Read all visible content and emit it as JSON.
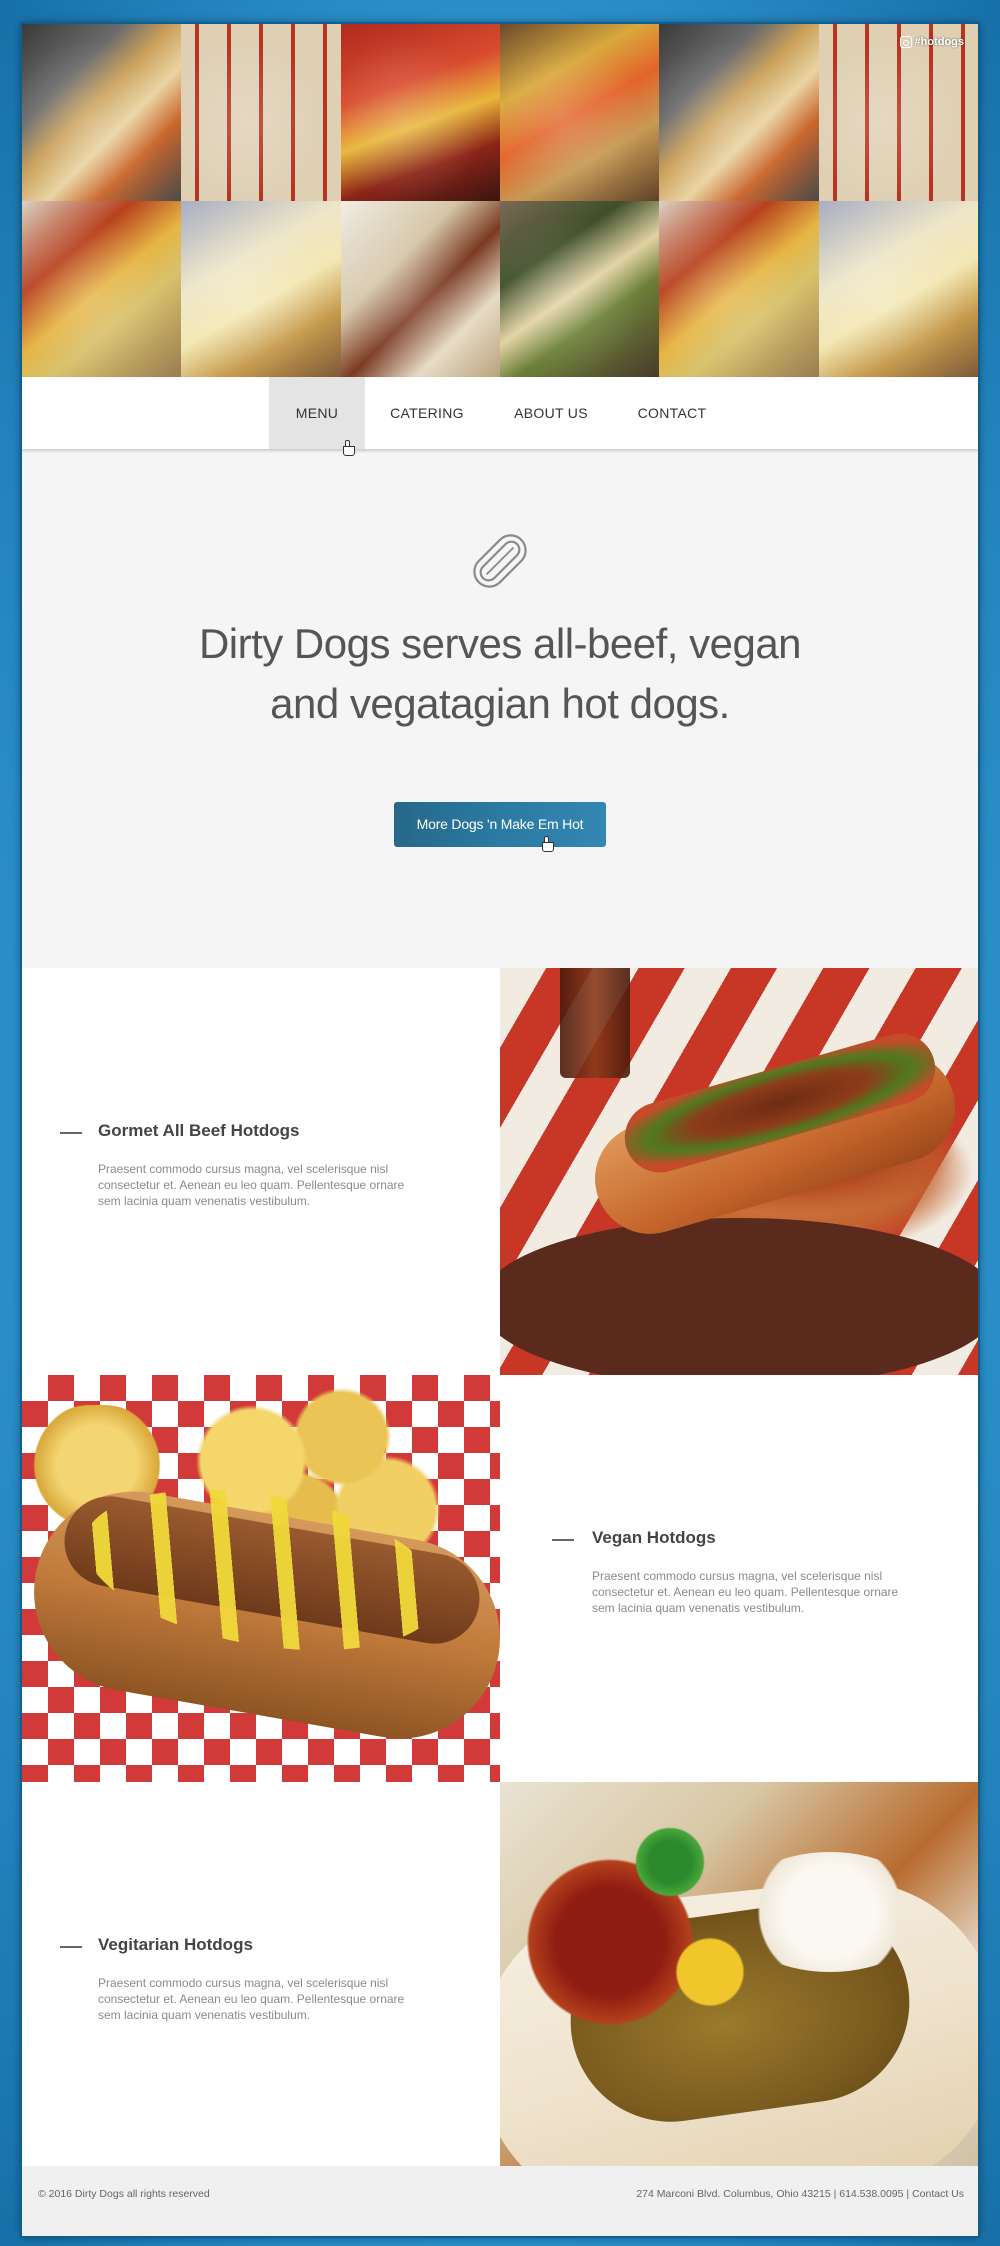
{
  "instagram": {
    "hashtag": "#hotdogs",
    "tiles": [
      {
        "subject": "hot dog with fries and coffee"
      },
      {
        "subject": "boxed hot dogs"
      },
      {
        "subject": "hot dog tray with fries and drink"
      },
      {
        "subject": "hot dogs with drinks"
      },
      {
        "subject": "hot dog with fries and coffee"
      },
      {
        "subject": "boxed hot dogs"
      },
      {
        "subject": "chili dog with chips"
      },
      {
        "subject": "cheese dog"
      },
      {
        "subject": "hot dog on board"
      },
      {
        "subject": "hot dog platter"
      },
      {
        "subject": "chili dog with chips"
      },
      {
        "subject": "cheese dog"
      }
    ]
  },
  "nav": {
    "items": [
      {
        "label": "MENU",
        "active": true
      },
      {
        "label": "CATERING",
        "active": false
      },
      {
        "label": "ABOUT US",
        "active": false
      },
      {
        "label": "CONTACT",
        "active": false
      }
    ]
  },
  "hero": {
    "icon": "hotdog-icon",
    "title_line1": "Dirty Dogs serves all-beef, vegan",
    "title_line2": "and vegatagian hot dogs.",
    "button_label": "More Dogs 'n Make Em Hot"
  },
  "products": [
    {
      "title": "Gormet All Beef Hotdogs",
      "description": "Praesent commodo cursus magna, vel scelerisque nisl consectetur et. Aenean eu leo quam. Pellentesque ornare sem lacinia quam venenatis vestibulum."
    },
    {
      "title": "Vegan Hotdogs",
      "description": "Praesent commodo cursus magna, vel scelerisque nisl consectetur et. Aenean eu leo quam. Pellentesque ornare sem lacinia quam venenatis vestibulum."
    },
    {
      "title": "Vegitarian Hotdogs",
      "description": "Praesent commodo cursus magna, vel scelerisque nisl consectetur et. Aenean eu leo quam. Pellentesque ornare sem lacinia quam venenatis vestibulum."
    }
  ],
  "footer": {
    "copyright": "© 2016 Dirty Dogs all rights reserved",
    "address": "274 Marconi Blvd. Columbus, Ohio 43215",
    "phone": "614.538.0095",
    "separator": "|",
    "contact_link": "Contact Us"
  },
  "colors": {
    "page_background": "#2a8fc9",
    "button": "#2a7aa2",
    "nav_active": "#e4e4e4",
    "hero_background": "#f5f5f5",
    "footer_background": "#f0f0f0"
  }
}
